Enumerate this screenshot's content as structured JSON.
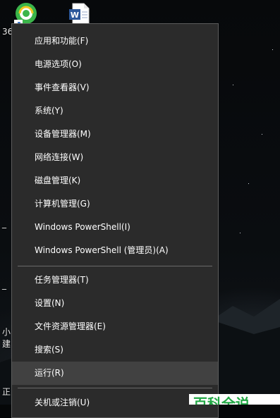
{
  "desktop": {
    "icon_label_fragment": "36",
    "side_fragments": [
      "_",
      "_",
      "小",
      "建",
      "正"
    ]
  },
  "menu": {
    "items": [
      {
        "label": "应用和功能(F)"
      },
      {
        "label": "电源选项(O)"
      },
      {
        "label": "事件查看器(V)"
      },
      {
        "label": "系统(Y)"
      },
      {
        "label": "设备管理器(M)"
      },
      {
        "label": "网络连接(W)"
      },
      {
        "label": "磁盘管理(K)"
      },
      {
        "label": "计算机管理(G)"
      },
      {
        "label": "Windows PowerShell(I)"
      },
      {
        "label": "Windows PowerShell (管理员)(A)"
      },
      {
        "label": "任务管理器(T)"
      },
      {
        "label": "设置(N)"
      },
      {
        "label": "文件资源管理器(E)"
      },
      {
        "label": "搜索(S)"
      },
      {
        "label": "运行(R)",
        "highlighted": true
      },
      {
        "label": "关机或注销(U)"
      }
    ]
  },
  "watermark": {
    "text": "百科全说"
  },
  "colors": {
    "menu_bg": "#2b2b2b",
    "menu_hover": "#414141",
    "menu_text": "#ffffff",
    "watermark_text": "#23a845"
  }
}
